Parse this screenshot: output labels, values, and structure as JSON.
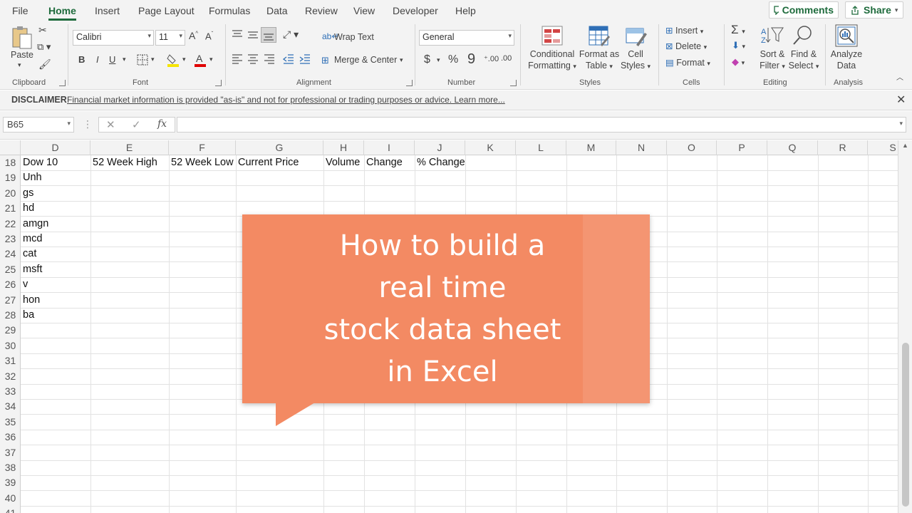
{
  "menu": {
    "tabs": [
      "File",
      "Home",
      "Insert",
      "Page Layout",
      "Formulas",
      "Data",
      "Review",
      "View",
      "Developer",
      "Help"
    ],
    "comments_label": "Comments",
    "share_label": "Share"
  },
  "ribbon": {
    "clipboard": {
      "paste_label": "Paste",
      "group_label": "Clipboard"
    },
    "font": {
      "font_name": "Calibri",
      "font_size": "11",
      "group_label": "Font"
    },
    "alignment": {
      "wrap_text": "Wrap Text",
      "merge_center": "Merge & Center",
      "group_label": "Alignment"
    },
    "number": {
      "format": "General",
      "group_label": "Number"
    },
    "styles": {
      "conditional_formatting": [
        "Conditional",
        "Formatting"
      ],
      "format_as_table": [
        "Format as",
        "Table"
      ],
      "cell_styles": [
        "Cell",
        "Styles"
      ],
      "group_label": "Styles"
    },
    "cells": {
      "insert": "Insert",
      "delete": "Delete",
      "format": "Format",
      "group_label": "Cells"
    },
    "editing": {
      "sort_filter": [
        "Sort &",
        "Filter"
      ],
      "find_select": [
        "Find &",
        "Select"
      ],
      "group_label": "Editing"
    },
    "analysis": {
      "analyze_data": [
        "Analyze",
        "Data"
      ],
      "group_label": "Analysis"
    }
  },
  "disclaimer": {
    "title": "DISCLAIMER",
    "text": "Financial market information is provided \"as-is\" and not for professional or trading purposes or advice. Learn more..."
  },
  "formula_bar": {
    "name_box": "B65",
    "fx": "fx",
    "formula": ""
  },
  "grid": {
    "columns": [
      "D",
      "E",
      "F",
      "G",
      "H",
      "I",
      "J",
      "K",
      "L",
      "M",
      "N",
      "O",
      "P",
      "Q",
      "R",
      "S"
    ],
    "rows": [
      "18",
      "19",
      "20",
      "21",
      "22",
      "23",
      "24",
      "25",
      "26",
      "27",
      "28",
      "29",
      "30",
      "31",
      "32",
      "33",
      "34",
      "35",
      "36",
      "37",
      "38",
      "39",
      "40",
      "41"
    ],
    "headers": [
      "Dow 10",
      "52 Week High",
      "52 Week Low",
      "Current Price",
      "Volume",
      "Change",
      "% Change"
    ],
    "tickers": [
      "Unh",
      "gs",
      "hd",
      "amgn",
      "mcd",
      "cat",
      "msft",
      "v",
      "hon",
      "ba"
    ]
  },
  "overlay": {
    "text": "How to build a\nreal time\nstock data sheet\nin Excel",
    "color": "#f38a63"
  },
  "colors": {
    "accent": "#1e6b3c",
    "ribbon_bg": "#f3f3f3"
  }
}
